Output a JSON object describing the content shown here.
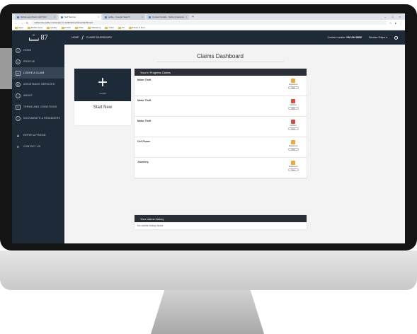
{
  "browser": {
    "tabs": [
      {
        "label": "Mobile app Mock-Up/FTGD",
        "active": false
      },
      {
        "label": "Self Service",
        "active": true
      },
      {
        "label": "selfse - Google Search",
        "active": false
      },
      {
        "label": "Contact Details - Sahra Insurance",
        "active": false
      }
    ],
    "new_tab": "+",
    "url": "selfservice-selfse.customapp.co.za/#/claims/claims/dashboard",
    "bookmarks": [
      "Apps",
      "Mobile Apps",
      "Quality",
      "FTGD",
      "Other",
      "Marketing",
      "Video",
      "Oil",
      "Prices & Fuel"
    ]
  },
  "sidebar": {
    "logo_text": "87",
    "items": [
      {
        "label": "HOME",
        "icon": "home-icon",
        "active": false
      },
      {
        "label": "PROFILE",
        "icon": "profile-icon",
        "active": false
      },
      {
        "label": "LODGE A CLAIM",
        "icon": "claim-icon",
        "active": true
      },
      {
        "label": "ASSISTANCE SERVICES",
        "icon": "assistance-icon",
        "active": false
      },
      {
        "label": "ABOUT",
        "icon": "info-icon",
        "active": false
      },
      {
        "label": "TERMS AND CONDITIONS",
        "icon": "document-icon",
        "active": false
      },
      {
        "label": "DOCUMENTS & REMINDERS",
        "icon": "reminder-icon",
        "active": false
      },
      {
        "label": "REFER A FRIEND",
        "icon": "refer-icon",
        "active": false
      },
      {
        "label": "CONTACT US",
        "icon": "phone-icon",
        "active": false
      }
    ]
  },
  "header": {
    "breadcrumb_home": "HOME",
    "breadcrumb_sep": "/",
    "breadcrumb_current": "CLAIMS DASHBOARD",
    "contact_label": "Contact number:",
    "contact_number": "032 244 8000",
    "user": "Sbusiso Sukpe ▾"
  },
  "main": {
    "title": "Claims Dashboard",
    "new_card": {
      "plus": "+",
      "sub": "CLAIM",
      "label": "Start New"
    },
    "in_progress": {
      "heading": "Your In Progress Claims",
      "claims": [
        {
          "name": "Motor Theft",
          "status": "Registered",
          "color": "#f0a830",
          "view": "View"
        },
        {
          "name": "Motor Theft",
          "status": "Notified",
          "color": "#e0483a",
          "view": "View"
        },
        {
          "name": "Motor Theft",
          "status": "Notified",
          "color": "#e0483a",
          "view": "View"
        },
        {
          "name": "Cell Phone",
          "status": "Registered",
          "color": "#f0a830",
          "view": "View"
        },
        {
          "name": "Jewellery",
          "status": "Registered",
          "color": "#f0a830",
          "view": "View"
        }
      ]
    },
    "history": {
      "heading": "Your claims history",
      "empty": "No claims history found"
    }
  }
}
